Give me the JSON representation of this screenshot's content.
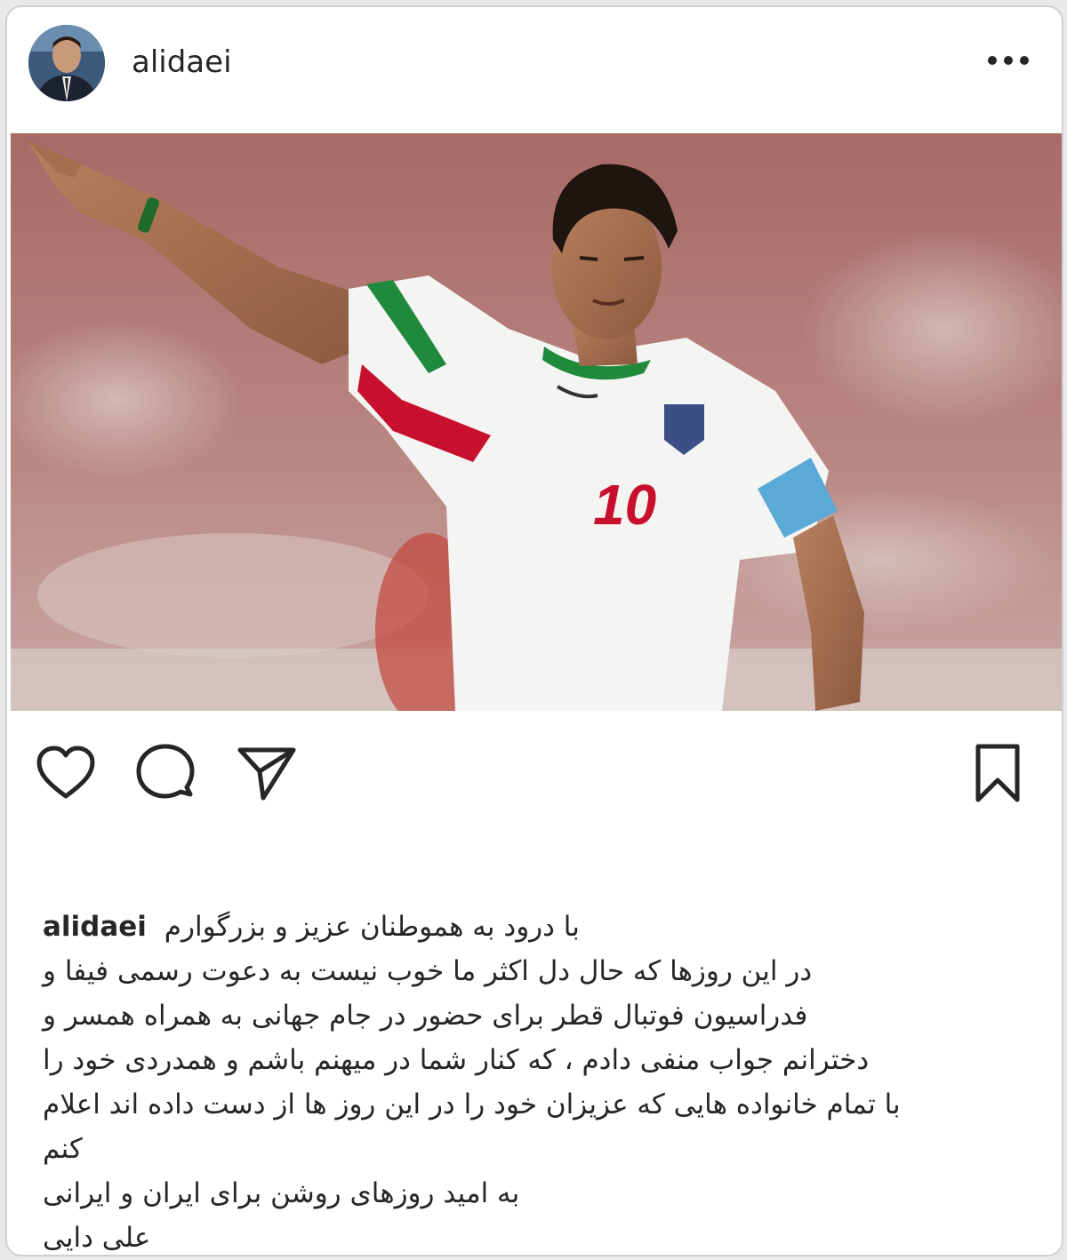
{
  "post": {
    "username": "alidaei",
    "caption": {
      "username": "alidaei",
      "first_line": "با درود به هموطنان عزیز و بزرگوارم",
      "lines": [
        "در این روزها که حال دل اکثر ما خوب نیست به دعوت رسمی فیفا و",
        "فدراسیون فوتبال قطر برای حضور در جام جهانی به همراه همسر و",
        "دخترانم جواب منفی دادم ، که کنار شما در میهنم باشم و همدردی خود را",
        "با تمام خانواده هایی که عزیزان خود را در این روز ها از دست داده اند اعلام",
        "کنم",
        "به امید روزهای روشن برای ایران و ایرانی",
        "علی دایی"
      ]
    },
    "photo": {
      "jersey_number": "10"
    }
  },
  "icons": {
    "more": "more-options-icon",
    "like": "heart-icon",
    "comment": "comment-icon",
    "share": "share-icon",
    "save": "bookmark-icon"
  },
  "colors": {
    "text": "#262626",
    "jersey_red": "#c8102e",
    "jersey_green": "#1f8a3c",
    "armband_blue": "#5aa9d6"
  }
}
